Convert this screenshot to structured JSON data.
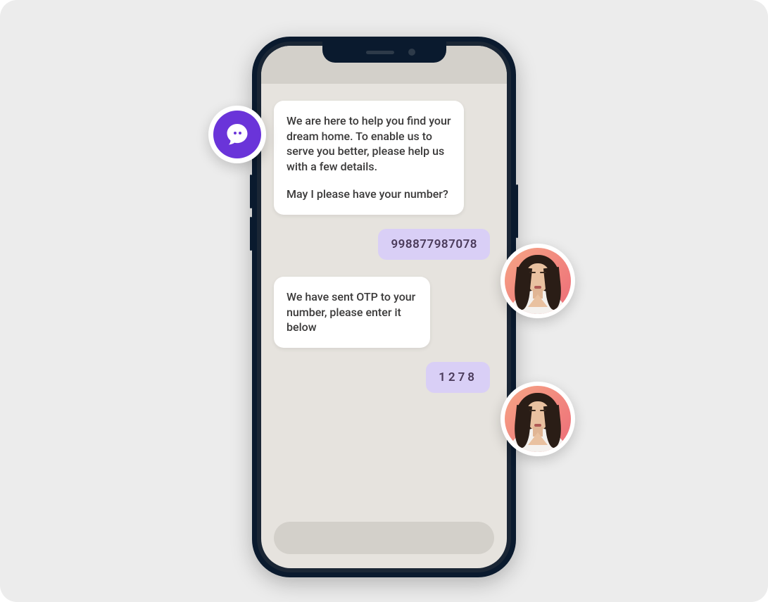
{
  "colors": {
    "accent": "#6a34d9",
    "user_bubble": "#d9cff6",
    "background": "#ececec",
    "screen_bg": "#e6e3de"
  },
  "bot_icon": "chat-bubble-icon",
  "chat": {
    "messages": [
      {
        "sender": "bot",
        "line1": "We are here to help you find your dream home. To enable us to serve you better, please help us with a few details.",
        "line2": "May I please have your number?"
      },
      {
        "sender": "user",
        "text": "998877987078"
      },
      {
        "sender": "bot",
        "line1": "We have sent OTP to your number, please enter it below"
      },
      {
        "sender": "user",
        "text": "1278"
      }
    ]
  },
  "input": {
    "placeholder": ""
  },
  "avatars": [
    {
      "desc": "user-avatar"
    },
    {
      "desc": "user-avatar"
    }
  ]
}
